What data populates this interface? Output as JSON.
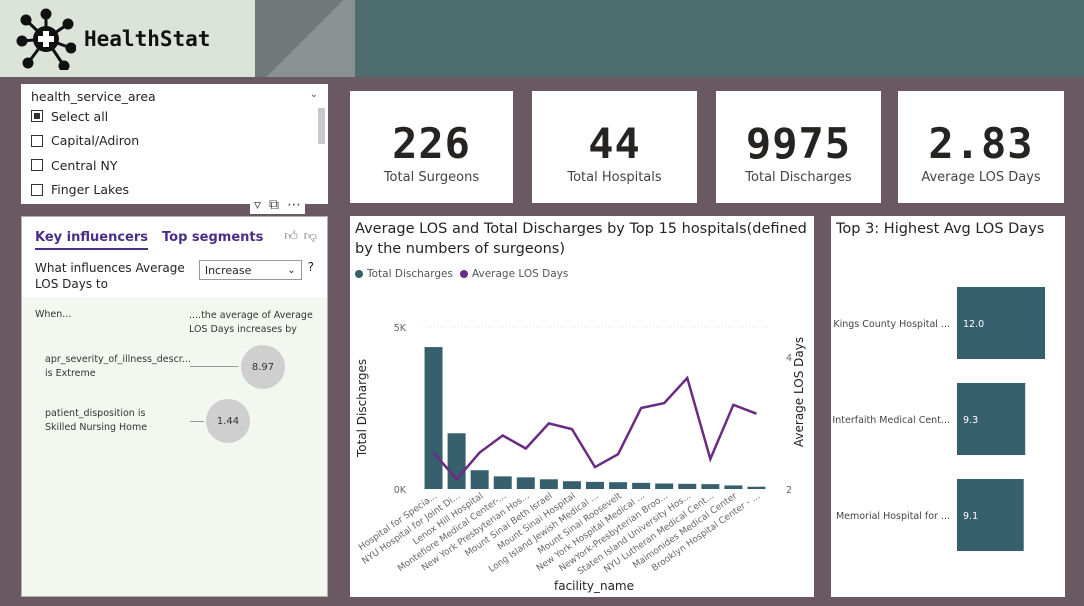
{
  "app": {
    "name": "HealthStat"
  },
  "slicer": {
    "field": "health_service_area",
    "items": [
      {
        "label": "Select all",
        "state": "partial"
      },
      {
        "label": "Capital/Adiron",
        "state": "off"
      },
      {
        "label": "Central NY",
        "state": "off"
      },
      {
        "label": "Finger Lakes",
        "state": "off"
      }
    ]
  },
  "kpis": [
    {
      "value": "226",
      "label": "Total Surgeons"
    },
    {
      "value": "44",
      "label": "Total Hospitals"
    },
    {
      "value": "9975",
      "label": "Total Discharges"
    },
    {
      "value": "2.83",
      "label": "Average LOS Days"
    }
  ],
  "key_influencers": {
    "tab_active": "Key influencers",
    "tab_other": "Top segments",
    "question": "What influences Average LOS Days to",
    "select_value": "Increase",
    "help": "?",
    "col_when": "When...",
    "col_avg": "....the average of Average LOS Days increases by",
    "influencers": [
      {
        "label": "apr_severity_of_illness_descr... is Extreme",
        "value": "8.97"
      },
      {
        "label": "patient_disposition is Skilled Nursing Home",
        "value": "1.44"
      }
    ]
  },
  "colors": {
    "teal": "#37606e",
    "purple": "#6a2c83",
    "background": "#6a5862",
    "header": "#4e6d6f"
  },
  "chart_data": [
    {
      "type": "bar+line",
      "title": "Average LOS and Total Discharges by Top 15 hospitals(defined by the numbers of surgeons)",
      "legend": [
        "Total Discharges",
        "Average LOS Days"
      ],
      "xlabel": "facility_name",
      "ylabel": "Total Discharges",
      "y2label": "Average LOS Days",
      "yticks": [
        "5K",
        "0K"
      ],
      "y2ticks": [
        "4",
        "2"
      ],
      "ylim": [
        0,
        5000
      ],
      "y2lim": [
        2,
        4
      ],
      "categories": [
        "Hospital for Specia...",
        "NYU Hospital for Joint Di...",
        "Lenox Hill Hospital",
        "Montefiore Medical Center-...",
        "New York Presbyterian Hos...",
        "Mount Sinai Beth Israel",
        "Mount Sinai Hospital",
        "Long Island Jewish Medical ...",
        "Mount Sinai Roosevelt",
        "New York Hospital Medical ...",
        "NewYork-Presbyterian Broo...",
        "Staten Island University Hos...",
        "NYU Lutheran Medical Cent...",
        "Maimonides Medical Center",
        "Brooklyn Hospital Center - ..."
      ],
      "series": [
        {
          "name": "Total Discharges",
          "values": [
            4380,
            1720,
            580,
            390,
            360,
            300,
            240,
            220,
            210,
            190,
            170,
            160,
            150,
            110,
            70
          ]
        },
        {
          "name": "Average LOS Days",
          "values": [
            2.45,
            2.12,
            2.45,
            2.66,
            2.5,
            2.81,
            2.74,
            2.27,
            2.43,
            3.0,
            3.06,
            3.37,
            2.37,
            3.04,
            2.93
          ]
        }
      ]
    },
    {
      "type": "bar",
      "orientation": "horizontal",
      "title": "Top 3: Highest Avg LOS Days",
      "categories": [
        "Kings County Hospital ...",
        "Interfaith Medical Cent...",
        "Memorial Hospital for ..."
      ],
      "values": [
        12.0,
        9.3,
        9.1
      ],
      "value_labels": [
        "12.0",
        "9.3",
        "9.1"
      ],
      "xlim": [
        0,
        12
      ]
    }
  ]
}
